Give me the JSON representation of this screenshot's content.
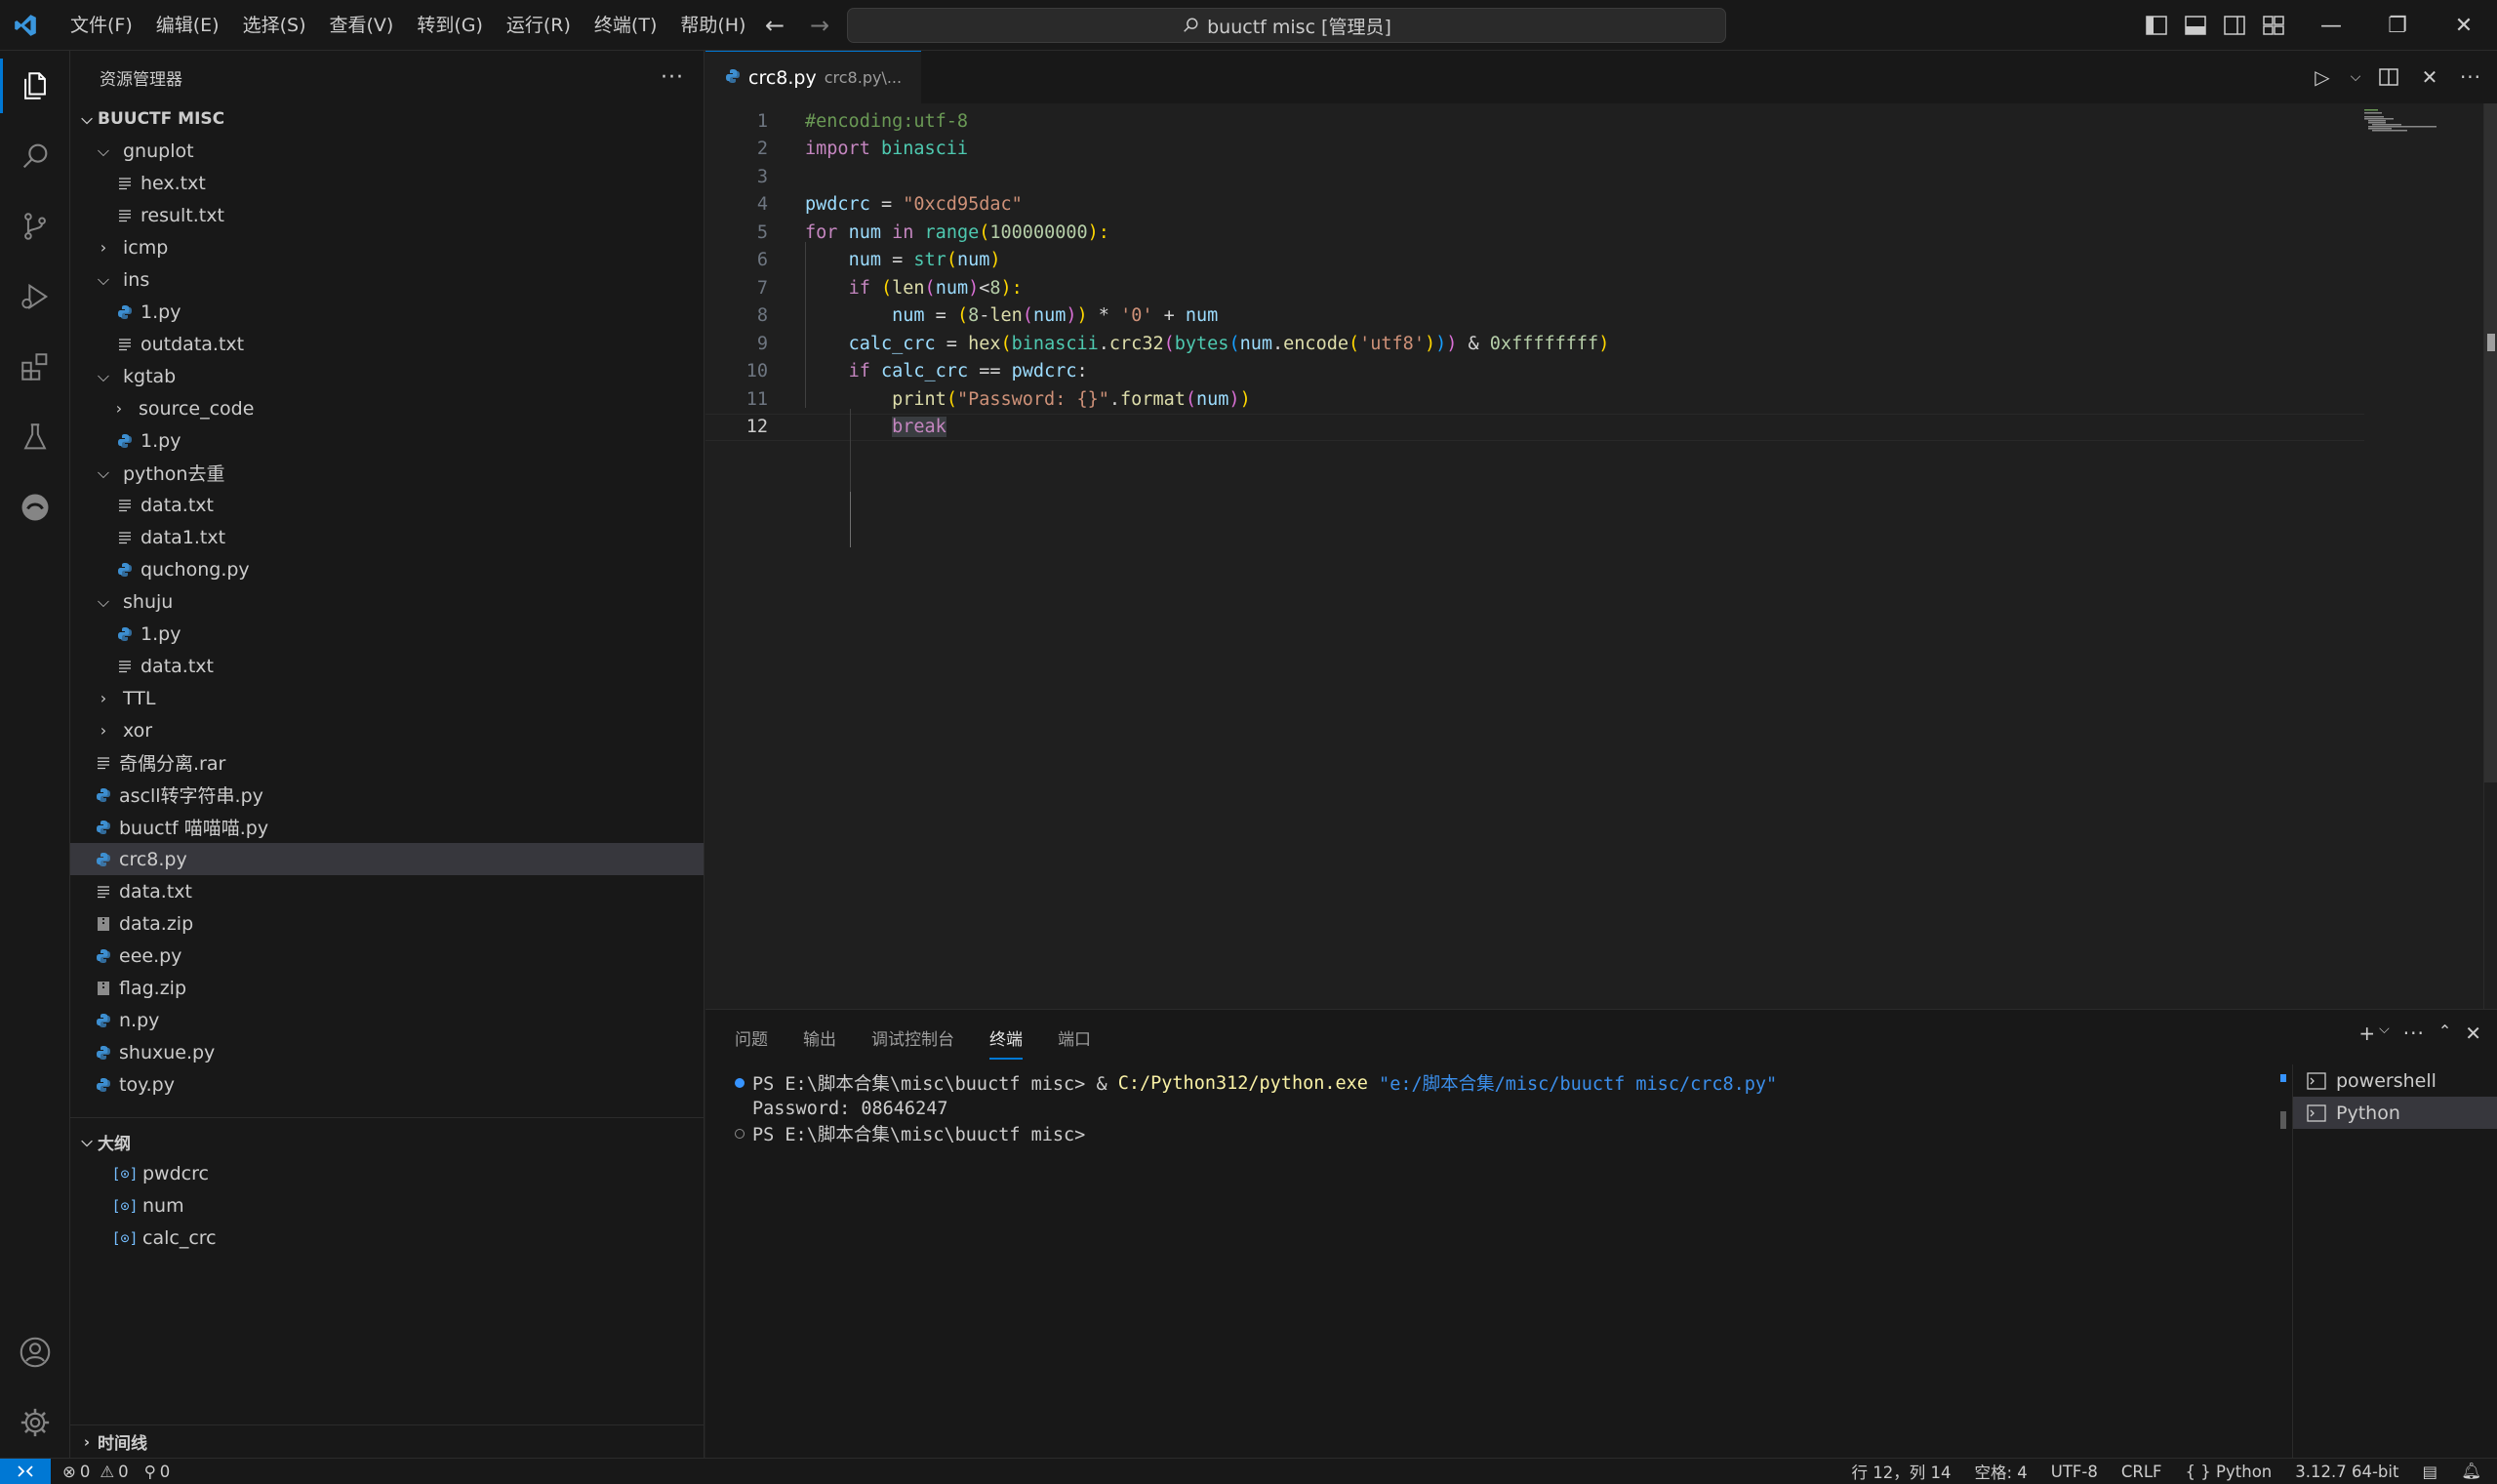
{
  "menu": [
    "文件(F)",
    "编辑(E)",
    "选择(S)",
    "查看(V)",
    "转到(G)",
    "运行(R)",
    "终端(T)",
    "帮助(H)"
  ],
  "search_text": "buuctf misc [管理员]",
  "sidebar": {
    "title": "资源管理器",
    "folder_name": "BUUCTF MISC",
    "tree": [
      {
        "label": "gnuplot",
        "type": "folder",
        "open": true,
        "depth": 0
      },
      {
        "label": "hex.txt",
        "type": "txt",
        "depth": 1
      },
      {
        "label": "result.txt",
        "type": "txt",
        "depth": 1
      },
      {
        "label": "icmp",
        "type": "folder",
        "open": false,
        "depth": 0
      },
      {
        "label": "ins",
        "type": "folder",
        "open": true,
        "depth": 0
      },
      {
        "label": "1.py",
        "type": "py",
        "depth": 1
      },
      {
        "label": "outdata.txt",
        "type": "txt",
        "depth": 1
      },
      {
        "label": "kgtab",
        "type": "folder",
        "open": true,
        "depth": 0
      },
      {
        "label": "source_code",
        "type": "folder",
        "open": false,
        "depth": 1
      },
      {
        "label": "1.py",
        "type": "py",
        "depth": 1
      },
      {
        "label": "python去重",
        "type": "folder",
        "open": true,
        "depth": 0
      },
      {
        "label": "data.txt",
        "type": "txt",
        "depth": 1
      },
      {
        "label": "data1.txt",
        "type": "txt",
        "depth": 1
      },
      {
        "label": "quchong.py",
        "type": "py",
        "depth": 1
      },
      {
        "label": "shuju",
        "type": "folder",
        "open": true,
        "depth": 0
      },
      {
        "label": "1.py",
        "type": "py",
        "depth": 1
      },
      {
        "label": "data.txt",
        "type": "txt",
        "depth": 1
      },
      {
        "label": "TTL",
        "type": "folder",
        "open": false,
        "depth": 0
      },
      {
        "label": "xor",
        "type": "folder",
        "open": false,
        "depth": 0
      },
      {
        "label": "奇偶分离.rar",
        "type": "txt",
        "depth": 0
      },
      {
        "label": "ascll转字符串.py",
        "type": "py",
        "depth": 0
      },
      {
        "label": "buuctf 喵喵喵.py",
        "type": "py",
        "depth": 0
      },
      {
        "label": "crc8.py",
        "type": "py",
        "depth": 0,
        "selected": true
      },
      {
        "label": "data.txt",
        "type": "txt",
        "depth": 0
      },
      {
        "label": "data.zip",
        "type": "zip",
        "depth": 0
      },
      {
        "label": "eee.py",
        "type": "py",
        "depth": 0
      },
      {
        "label": "flag.zip",
        "type": "zip",
        "depth": 0
      },
      {
        "label": "n.py",
        "type": "py",
        "depth": 0
      },
      {
        "label": "shuxue.py",
        "type": "py",
        "depth": 0
      },
      {
        "label": "toy.py",
        "type": "py",
        "depth": 0
      }
    ],
    "outline_title": "大纲",
    "outline": [
      "pwdcrc",
      "num",
      "calc_crc"
    ],
    "timeline_title": "时间线"
  },
  "editor": {
    "tab_name": "crc8.py",
    "tab_path": "crc8.py\\...",
    "current_line": 12,
    "lines": [
      [
        [
          "#encoding:utf-8",
          "c-comment"
        ]
      ],
      [
        [
          "import",
          "c-kw"
        ],
        [
          " ",
          "c-op"
        ],
        [
          "binascii",
          "c-cls"
        ]
      ],
      [],
      [
        [
          "pwdcrc",
          "c-var"
        ],
        [
          " = ",
          "c-op"
        ],
        [
          "\"0xcd95dac\"",
          "c-str"
        ]
      ],
      [
        [
          "for",
          "c-kw"
        ],
        [
          " ",
          "c-op"
        ],
        [
          "num",
          "c-var"
        ],
        [
          " ",
          "c-op"
        ],
        [
          "in",
          "c-kw"
        ],
        [
          " ",
          "c-op"
        ],
        [
          "range",
          "c-cls"
        ],
        [
          "(",
          "c-br1"
        ],
        [
          "100000000",
          "c-num"
        ],
        [
          "):",
          "c-br1"
        ]
      ],
      [
        [
          "    ",
          "c-op"
        ],
        [
          "num",
          "c-var"
        ],
        [
          " = ",
          "c-op"
        ],
        [
          "str",
          "c-cls"
        ],
        [
          "(",
          "c-br1"
        ],
        [
          "num",
          "c-var"
        ],
        [
          ")",
          "c-br1"
        ]
      ],
      [
        [
          "    ",
          "c-op"
        ],
        [
          "if",
          "c-kw"
        ],
        [
          " ",
          "c-op"
        ],
        [
          "(",
          "c-br1"
        ],
        [
          "len",
          "c-fn"
        ],
        [
          "(",
          "c-br2"
        ],
        [
          "num",
          "c-var"
        ],
        [
          ")",
          "c-br2"
        ],
        [
          "<",
          "c-op"
        ],
        [
          "8",
          "c-num"
        ],
        [
          "):",
          "c-br1"
        ]
      ],
      [
        [
          "        ",
          "c-op"
        ],
        [
          "num",
          "c-var"
        ],
        [
          " = ",
          "c-op"
        ],
        [
          "(",
          "c-br1"
        ],
        [
          "8",
          "c-num"
        ],
        [
          "-",
          "c-op"
        ],
        [
          "len",
          "c-fn"
        ],
        [
          "(",
          "c-br2"
        ],
        [
          "num",
          "c-var"
        ],
        [
          ")",
          "c-br2"
        ],
        [
          ")",
          "c-br1"
        ],
        [
          " * ",
          "c-op"
        ],
        [
          "'0'",
          "c-str"
        ],
        [
          " + ",
          "c-op"
        ],
        [
          "num",
          "c-var"
        ]
      ],
      [
        [
          "    ",
          "c-op"
        ],
        [
          "calc_crc",
          "c-var"
        ],
        [
          " = ",
          "c-op"
        ],
        [
          "hex",
          "c-fn"
        ],
        [
          "(",
          "c-br1"
        ],
        [
          "binascii",
          "c-cls"
        ],
        [
          ".",
          "c-op"
        ],
        [
          "crc32",
          "c-fn"
        ],
        [
          "(",
          "c-br2"
        ],
        [
          "bytes",
          "c-cls"
        ],
        [
          "(",
          "c-br3"
        ],
        [
          "num",
          "c-var"
        ],
        [
          ".",
          "c-op"
        ],
        [
          "encode",
          "c-fn"
        ],
        [
          "(",
          "c-br1"
        ],
        [
          "'utf8'",
          "c-str"
        ],
        [
          ")",
          "c-br1"
        ],
        [
          ")",
          "c-br3"
        ],
        [
          ")",
          "c-br2"
        ],
        [
          " & ",
          "c-op"
        ],
        [
          "0xffffffff",
          "c-num"
        ],
        [
          ")",
          "c-br1"
        ]
      ],
      [
        [
          "    ",
          "c-op"
        ],
        [
          "if",
          "c-kw"
        ],
        [
          " ",
          "c-op"
        ],
        [
          "calc_crc",
          "c-var"
        ],
        [
          " == ",
          "c-op"
        ],
        [
          "pwdcrc",
          "c-var"
        ],
        [
          ":",
          "c-op"
        ]
      ],
      [
        [
          "        ",
          "c-op"
        ],
        [
          "print",
          "c-fn"
        ],
        [
          "(",
          "c-br1"
        ],
        [
          "\"Password: {}\"",
          "c-str"
        ],
        [
          ".",
          "c-op"
        ],
        [
          "format",
          "c-fn"
        ],
        [
          "(",
          "c-br2"
        ],
        [
          "num",
          "c-var"
        ],
        [
          ")",
          "c-br2"
        ],
        [
          ")",
          "c-br1"
        ]
      ],
      [
        [
          "        ",
          "c-op"
        ],
        [
          "break",
          "c-kw"
        ]
      ]
    ]
  },
  "panel": {
    "tabs": [
      "问题",
      "输出",
      "调试控制台",
      "终端",
      "端口"
    ],
    "active_tab": "终端",
    "terminal": {
      "line1_prompt": "PS E:\\脚本合集\\misc\\buuctf misc> & ",
      "line1_exe": "C:/Python312/python.exe",
      "line1_arg": " \"e:/脚本合集/misc/buuctf misc/crc8.py\"",
      "line2": "Password: 08646247",
      "line3": "PS E:\\脚本合集\\misc\\buuctf misc>"
    },
    "terminals": [
      "powershell",
      "Python"
    ]
  },
  "statusbar": {
    "errors": "0",
    "warnings": "0",
    "ports": "0",
    "position": "行 12，列 14",
    "spaces": "空格: 4",
    "encoding": "UTF-8",
    "eol": "CRLF",
    "language": "Python",
    "interpreter": "3.12.7 64-bit"
  },
  "colors": {
    "accent": "#0078d4",
    "background": "#1f1f1f",
    "sidebar": "#181818"
  }
}
